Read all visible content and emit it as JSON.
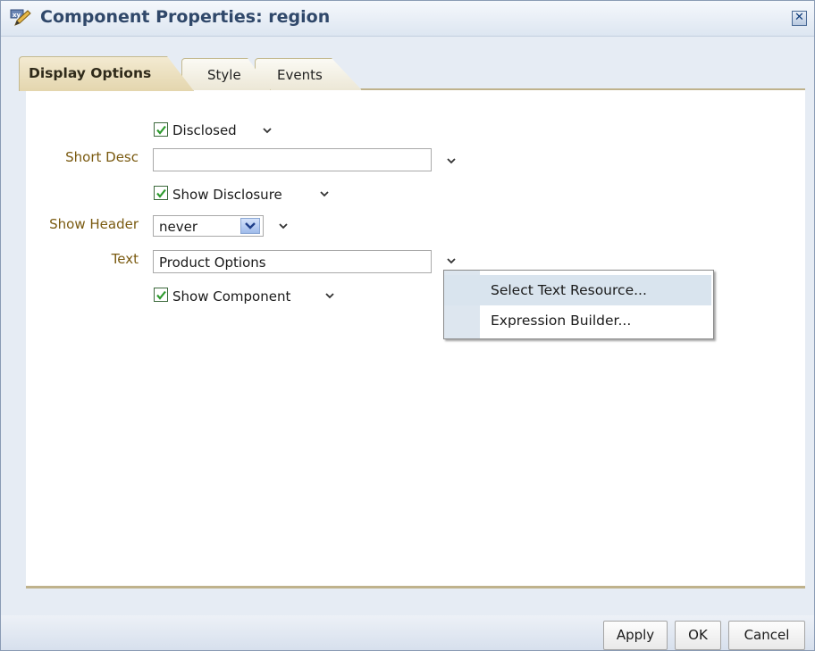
{
  "dialog": {
    "title": "Component Properties: region",
    "title_icon": "xy-edit-icon",
    "close_icon": "close-icon"
  },
  "tabs": [
    {
      "label": "Display Options",
      "active": true
    },
    {
      "label": "Style",
      "active": false
    },
    {
      "label": "Events",
      "active": false
    }
  ],
  "form": {
    "disclosed": {
      "label": "Disclosed",
      "checked": true
    },
    "short_desc": {
      "label": "Short Desc",
      "value": ""
    },
    "show_disclosure": {
      "label": "Show Disclosure",
      "checked": true
    },
    "show_header": {
      "label": "Show Header",
      "value": "never"
    },
    "text": {
      "label": "Text",
      "value": "Product Options"
    },
    "show_component": {
      "label": "Show Component",
      "checked": true
    }
  },
  "popup_menu": {
    "items": [
      "Select Text Resource...",
      "Expression Builder..."
    ]
  },
  "buttons": {
    "apply": "Apply",
    "ok": "OK",
    "cancel": "Cancel"
  },
  "colors": {
    "label": "#7a5a10",
    "active_tab": "#e4d6ae",
    "check": "#2d9b2d",
    "title": "#30486a"
  }
}
